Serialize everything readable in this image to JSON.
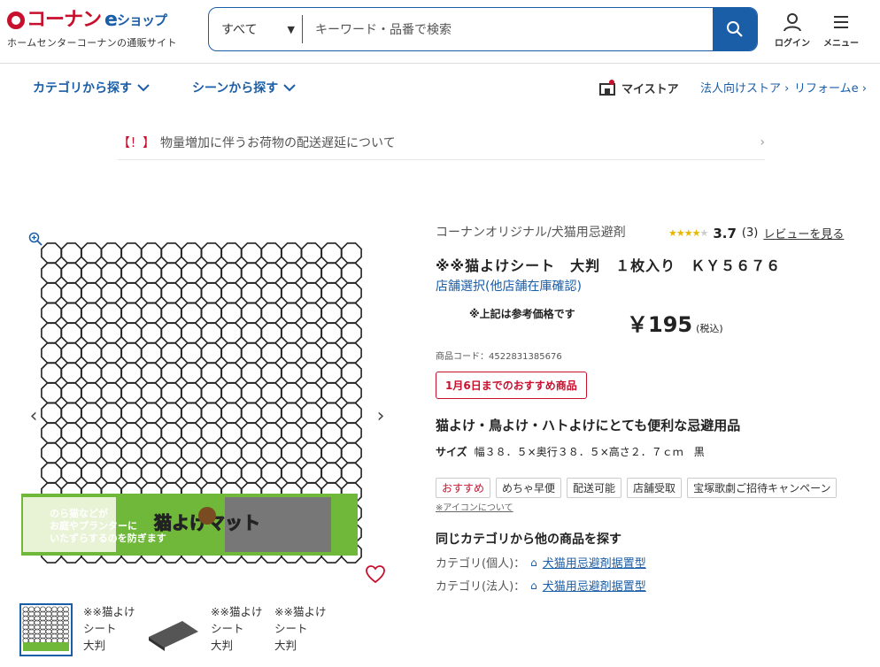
{
  "header": {
    "logo_main": "コーナン",
    "logo_e": "e",
    "logo_shop": "ショップ",
    "logo_sub": "ホームセンターコーナンの通販サイト",
    "search_category": "すべて",
    "search_placeholder": "キーワード・品番で検索",
    "login_label": "ログイン",
    "menu_label": "メニュー"
  },
  "nav": {
    "category": "カテゴリから探す",
    "scene": "シーンから探す",
    "mystore": "マイストア",
    "corporate": "法人向けストア ›",
    "reform": "リフォームe ›"
  },
  "notice": {
    "mark": "【！】",
    "text": "物量増加に伴うお荷物の配送遅延について"
  },
  "product": {
    "brand": "コーナンオリジナル/犬猫用忌避剤",
    "rating": "3.7",
    "review_count": "(3)",
    "review_link": "レビューを見る",
    "name": "※※猫よけシート　大判　１枚入り　ＫＹ５６７６",
    "store_select": "店舗選択(他店舗在庫確認)",
    "price_note": "※上記は参考価格です",
    "price": "￥195",
    "tax": "(税込)",
    "code": "商品コード：4522831385676",
    "promo": "1月6日までのおすすめ商品",
    "catch": "猫よけ・鳥よけ・ハトよけにとても便利な忌避用品",
    "size_label": "サイズ",
    "size_value": "幅３８．５×奥行３８．５×高さ２．７ｃｍ　黒",
    "tags": [
      "おすすめ",
      "めちゃ早便",
      "配送可能",
      "店舗受取",
      "宝塚歌劇ご招待キャンペーン"
    ],
    "icon_link": "※アイコンについて",
    "same_category": "同じカテゴリから他の商品を探す",
    "cat_personal_label": "カテゴリ(個人)：",
    "cat_personal_link": "犬猫用忌避剤据置型",
    "cat_corp_label": "カテゴリ(法人)：",
    "cat_corp_link": "犬猫用忌避剤据置型"
  },
  "gallery": {
    "prev": "‹",
    "next": "›",
    "package_text1": "のら猫などが",
    "package_text2": "お庭やプランターに",
    "package_text3": "いたずらするのを防ぎます",
    "package_title": "猫よけマット",
    "thumb_alt": "※※猫よけシート　大判"
  },
  "colors": {
    "brand_blue": "#1a5ea8",
    "brand_red": "#c8102e"
  }
}
